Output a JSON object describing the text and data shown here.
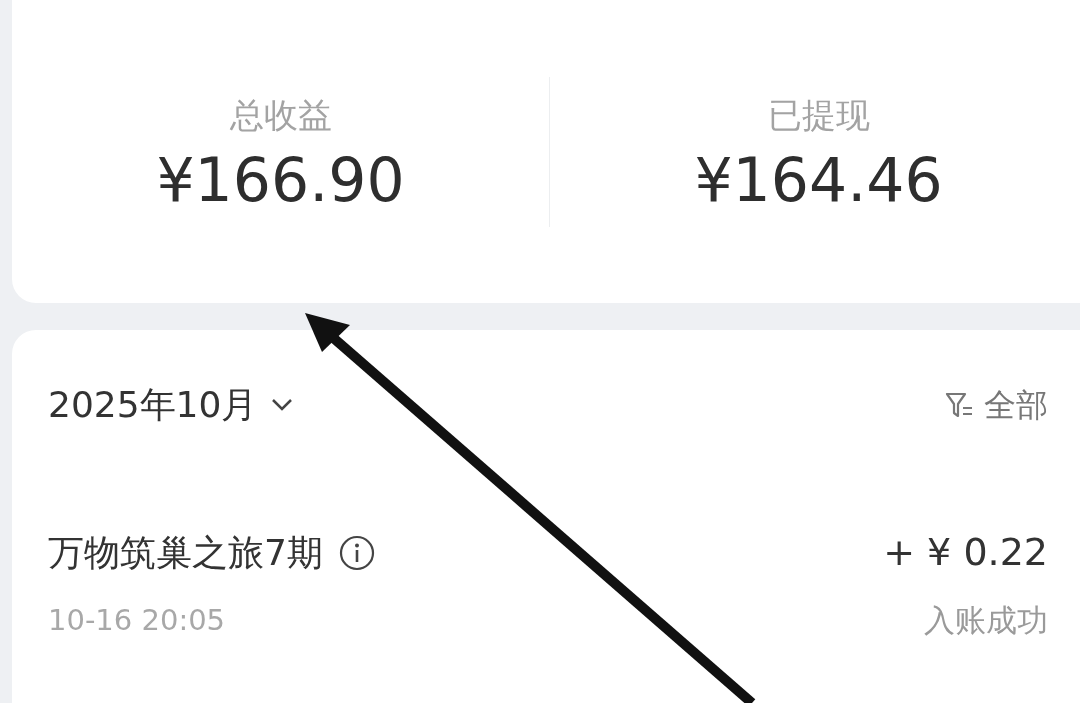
{
  "summary": [
    {
      "label": "总收益",
      "value": "¥166.90"
    },
    {
      "label": "已提现",
      "value": "¥164.46"
    }
  ],
  "month_selector": {
    "label": "2025年10月"
  },
  "filter": {
    "label": "全部"
  },
  "transactions": [
    {
      "title": "万物筑巢之旅7期",
      "amount": "+ ¥ 0.22",
      "time": "10-16 20:05",
      "status": "入账成功"
    }
  ]
}
